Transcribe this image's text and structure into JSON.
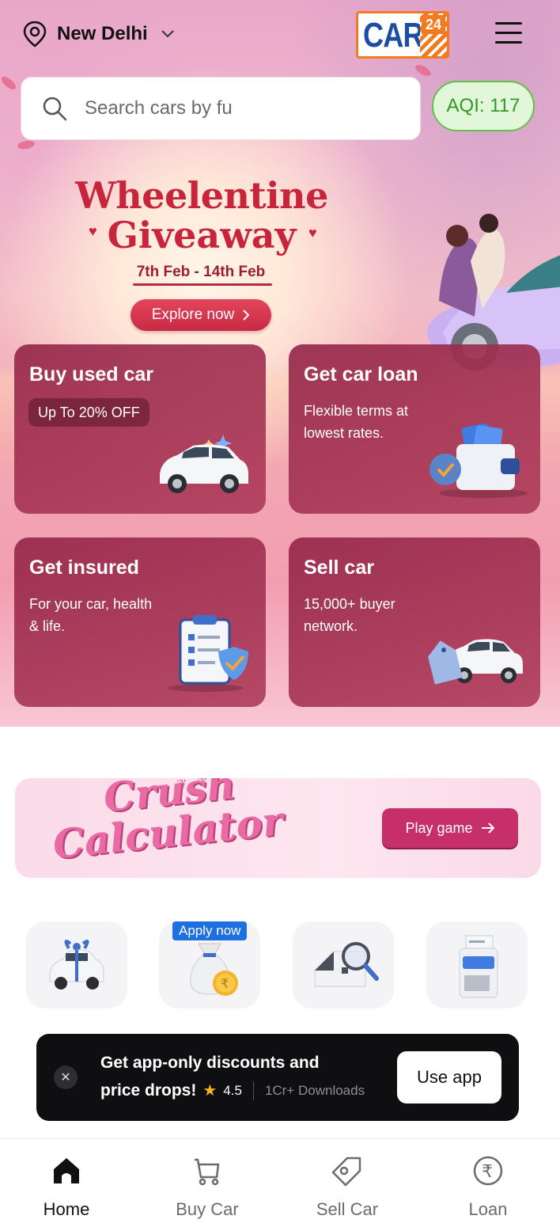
{
  "header": {
    "location": "New Delhi",
    "logo_text": "CARS",
    "logo_number": "24"
  },
  "search": {
    "placeholder": "Search cars by fu"
  },
  "aqi": {
    "label": "AQI: 117"
  },
  "banner": {
    "title_line1": "Wheelentine",
    "title_line2": "Giveaway",
    "dates": "7th Feb - 14th Feb",
    "cta": "Explore now"
  },
  "cards": [
    {
      "title": "Buy used car",
      "badge": "Up To 20% OFF"
    },
    {
      "title": "Get car loan",
      "subtitle": "Flexible terms at lowest rates."
    },
    {
      "title": "Get insured",
      "subtitle": "For your car, health & life."
    },
    {
      "title": "Sell car",
      "subtitle": "15,000+ buyer network."
    }
  ],
  "crush": {
    "title_word1": "Crush",
    "title_word2": "Calculator",
    "cta": "Play game"
  },
  "tiles": {
    "apply_badge": "Apply now"
  },
  "app_banner": {
    "line1": "Get app-only discounts and",
    "line2": "price drops!",
    "rating": "4.5",
    "downloads": "1Cr+ Downloads",
    "cta": "Use app"
  },
  "bottom_nav": [
    {
      "label": "Home",
      "icon": "home-icon"
    },
    {
      "label": "Buy Car",
      "icon": "cart-icon"
    },
    {
      "label": "Sell Car",
      "icon": "tag-icon"
    },
    {
      "label": "Loan",
      "icon": "rupee-icon"
    }
  ],
  "colors": {
    "brand_blue": "#1b4ea3",
    "brand_orange": "#f47a20",
    "card_maroon": "#96284b",
    "aqi_green": "#2f9a22"
  }
}
